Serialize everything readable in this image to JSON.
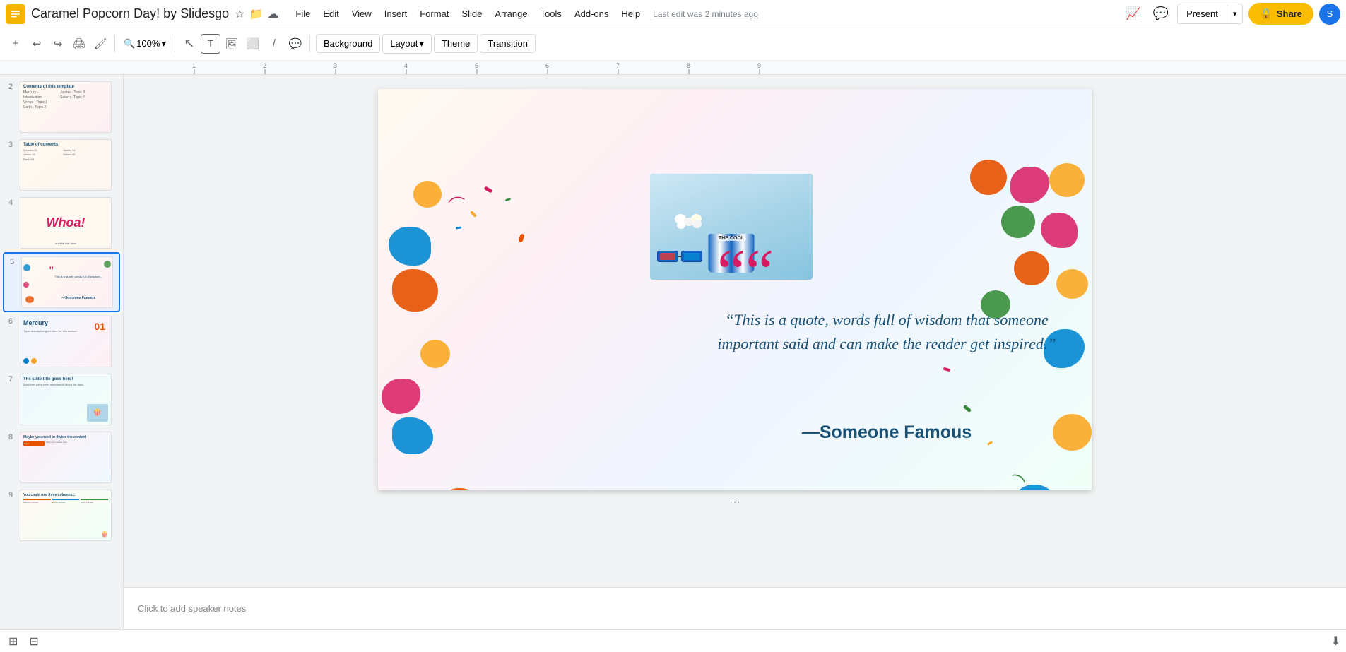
{
  "app": {
    "icon": "🎞",
    "title": "Caramel Popcorn Day! by Slidesgo",
    "star_icon": "☆",
    "folder_icon": "📁",
    "cloud_icon": "☁"
  },
  "menu": {
    "file": "File",
    "edit": "Edit",
    "view": "View",
    "insert": "Insert",
    "format": "Format",
    "slide": "Slide",
    "arrange": "Arrange",
    "tools": "Tools",
    "addons": "Add-ons",
    "help": "Help",
    "last_edit": "Last edit was 2 minutes ago"
  },
  "toolbar": {
    "zoom": "100%",
    "background": "Background",
    "layout": "Layout",
    "theme": "Theme",
    "transition": "Transition"
  },
  "topright": {
    "present": "Present",
    "share": "Share"
  },
  "slide": {
    "quote_mark": "““",
    "quote_text": "“This is a quote, words full of wisdom that someone important said and can make the reader get inspired.”",
    "quote_author": "—Someone Famous"
  },
  "slides": [
    {
      "num": "2",
      "label": "Contents slide"
    },
    {
      "num": "3",
      "label": "Table of contents"
    },
    {
      "num": "4",
      "label": "Whoa slide"
    },
    {
      "num": "5",
      "label": "Quote slide",
      "active": true
    },
    {
      "num": "6",
      "label": "Mercury slide"
    },
    {
      "num": "7",
      "label": "Slide title goes here"
    },
    {
      "num": "8",
      "label": "Divide content"
    },
    {
      "num": "9",
      "label": "Three columns"
    }
  ],
  "notes": {
    "placeholder": "Click to add speaker notes"
  },
  "colors": {
    "accent_yellow": "#fbbc04",
    "accent_blue": "#1a73e8",
    "quote_pink": "#d81b60",
    "text_blue": "#1a5276",
    "blob_orange": "#e65100",
    "blob_pink": "#d81b60",
    "blob_blue": "#0288d1",
    "blob_yellow": "#f9a825",
    "blob_green": "#388e3c",
    "blob_teal": "#00897b"
  }
}
